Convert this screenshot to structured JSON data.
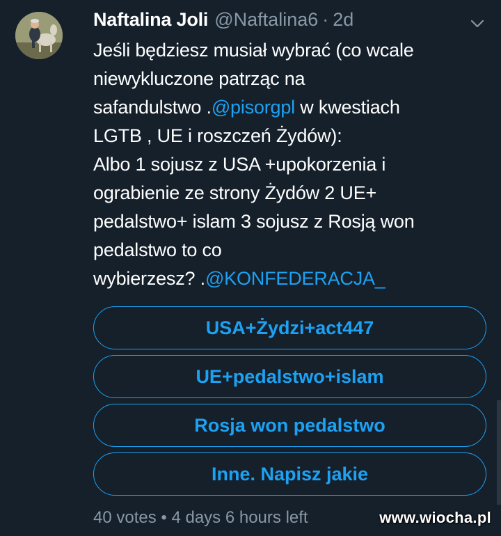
{
  "tweet": {
    "author": {
      "display_name": "Naftalina Joli",
      "handle": "@Naftalina6",
      "separator": "·",
      "time": "2d"
    },
    "text": {
      "line1": "Jeśli będziesz musiał wybrać (co wcale",
      "line2": "niewykluczone patrząc na",
      "line3_a": "safandulstwo .",
      "line3_mention": "@pisorgpl",
      "line3_b": " w kwestiach",
      "line4": "LGTB , UE i roszczeń Żydów):",
      "line5": "Albo 1 sojusz z USA +upokorzenia i",
      "line6": "ograbienie ze strony Żydów 2 UE+",
      "line7": "pedalstwo+ islam 3 sojusz z Rosją won",
      "line8": "pedalstwo to co",
      "line9_a": "wybierzesz? .",
      "line9_mention": "@KONFEDERACJA_"
    },
    "poll": {
      "options": [
        "USA+Żydzi+act447",
        "UE+pedalstwo+islam",
        "Rosja won pedalstwo",
        "Inne. Napisz jakie"
      ],
      "meta": "40 votes • 4 days 6 hours left"
    }
  },
  "watermark": "www.wiocha.pl",
  "colors": {
    "background": "#15202b",
    "accent": "#1da1f2",
    "secondary_text": "#8899a6",
    "primary_text": "#ffffff"
  },
  "icons": {
    "caret": "chevron-down-icon",
    "avatar": "avatar-image"
  }
}
